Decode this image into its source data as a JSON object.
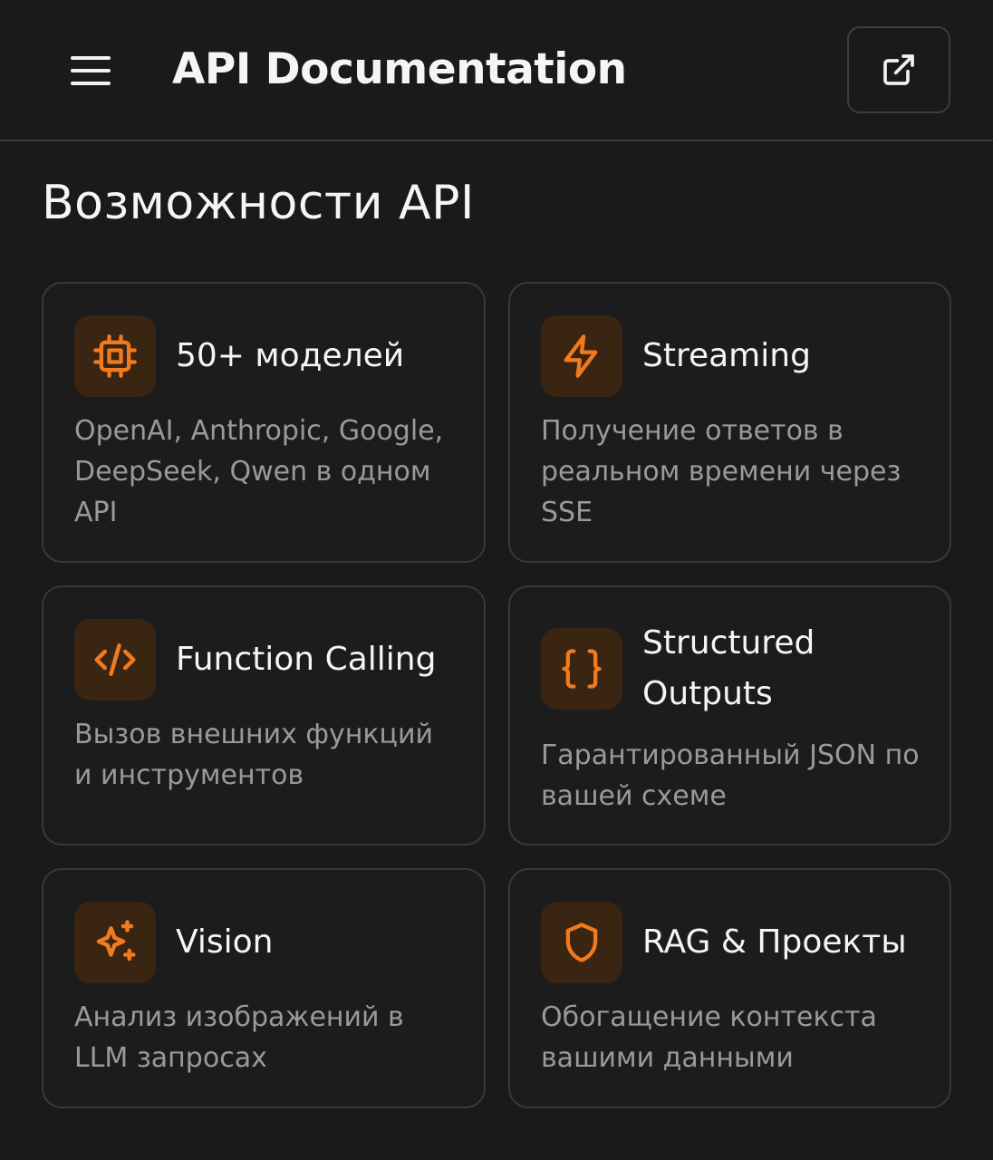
{
  "header": {
    "title": "API Documentation",
    "menu_icon": "hamburger-menu-icon",
    "external_icon": "external-link-icon"
  },
  "section": {
    "title": "Возможности API"
  },
  "accent_color": "#f07a1e",
  "cards": [
    {
      "icon": "cpu-chip-icon",
      "title": "50+ моделей",
      "desc_lines": [
        "OpenAI, Anthropic, Google,",
        "DeepSeek, Qwen в одном",
        "API"
      ]
    },
    {
      "icon": "lightning-bolt-icon",
      "title": "Streaming",
      "desc_lines": [
        "Получение ответов в",
        "реальном времени через",
        "SSE"
      ]
    },
    {
      "icon": "code-brackets-icon",
      "title": "Function Calling",
      "desc_lines": [
        "Вызов внешних функций",
        "и инструментов"
      ]
    },
    {
      "icon": "curly-braces-icon",
      "title_lines": [
        "Structured",
        "Outputs"
      ],
      "desc_lines": [
        "Гарантированный JSON по",
        "вашей схеме"
      ]
    },
    {
      "icon": "sparkles-icon",
      "title": "Vision",
      "desc_lines": [
        "Анализ изображений в",
        "LLM запросах"
      ]
    },
    {
      "icon": "shield-icon",
      "title": "RAG & Проекты",
      "desc_lines": [
        "Обогащение контекста",
        "вашими данными"
      ]
    }
  ]
}
